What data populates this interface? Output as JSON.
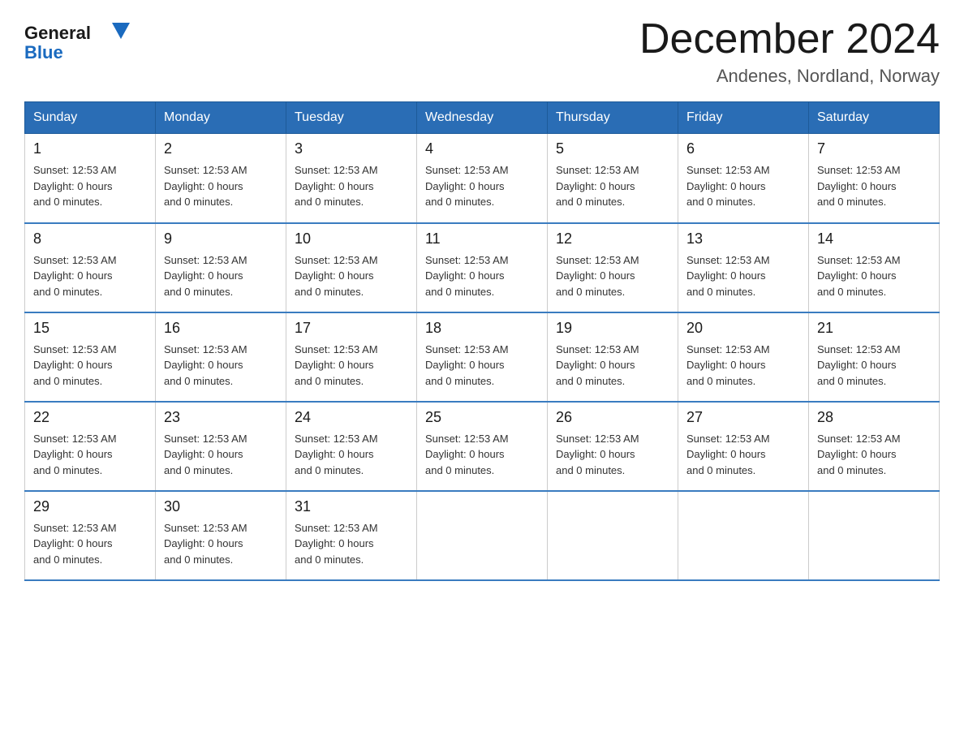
{
  "logo": {
    "brand_black": "General",
    "brand_blue": "Blue"
  },
  "header": {
    "title": "December 2024",
    "subtitle": "Andenes, Nordland, Norway"
  },
  "weekdays": [
    "Sunday",
    "Monday",
    "Tuesday",
    "Wednesday",
    "Thursday",
    "Friday",
    "Saturday"
  ],
  "day_info_template": {
    "sunset": "Sunset: 12:53 AM",
    "daylight": "Daylight: 0 hours",
    "minutes": "and 0 minutes."
  },
  "weeks": [
    {
      "days": [
        {
          "num": "1",
          "info": true
        },
        {
          "num": "2",
          "info": true
        },
        {
          "num": "3",
          "info": true
        },
        {
          "num": "4",
          "info": true
        },
        {
          "num": "5",
          "info": true
        },
        {
          "num": "6",
          "info": true
        },
        {
          "num": "7",
          "info": true
        }
      ]
    },
    {
      "days": [
        {
          "num": "8",
          "info": true
        },
        {
          "num": "9",
          "info": true
        },
        {
          "num": "10",
          "info": true
        },
        {
          "num": "11",
          "info": true
        },
        {
          "num": "12",
          "info": true
        },
        {
          "num": "13",
          "info": true
        },
        {
          "num": "14",
          "info": true
        }
      ]
    },
    {
      "days": [
        {
          "num": "15",
          "info": true
        },
        {
          "num": "16",
          "info": true
        },
        {
          "num": "17",
          "info": true
        },
        {
          "num": "18",
          "info": true
        },
        {
          "num": "19",
          "info": true
        },
        {
          "num": "20",
          "info": true
        },
        {
          "num": "21",
          "info": true
        }
      ]
    },
    {
      "days": [
        {
          "num": "22",
          "info": true
        },
        {
          "num": "23",
          "info": true
        },
        {
          "num": "24",
          "info": true
        },
        {
          "num": "25",
          "info": true
        },
        {
          "num": "26",
          "info": true
        },
        {
          "num": "27",
          "info": true
        },
        {
          "num": "28",
          "info": true
        }
      ]
    },
    {
      "days": [
        {
          "num": "29",
          "info": true
        },
        {
          "num": "30",
          "info": true
        },
        {
          "num": "31",
          "info": true
        },
        {
          "num": "",
          "info": false
        },
        {
          "num": "",
          "info": false
        },
        {
          "num": "",
          "info": false
        },
        {
          "num": "",
          "info": false
        }
      ]
    }
  ],
  "sunset_line": "Sunset: 12:53 AM",
  "daylight_line1": "Daylight: 0 hours",
  "daylight_line2": "and 0 minutes."
}
